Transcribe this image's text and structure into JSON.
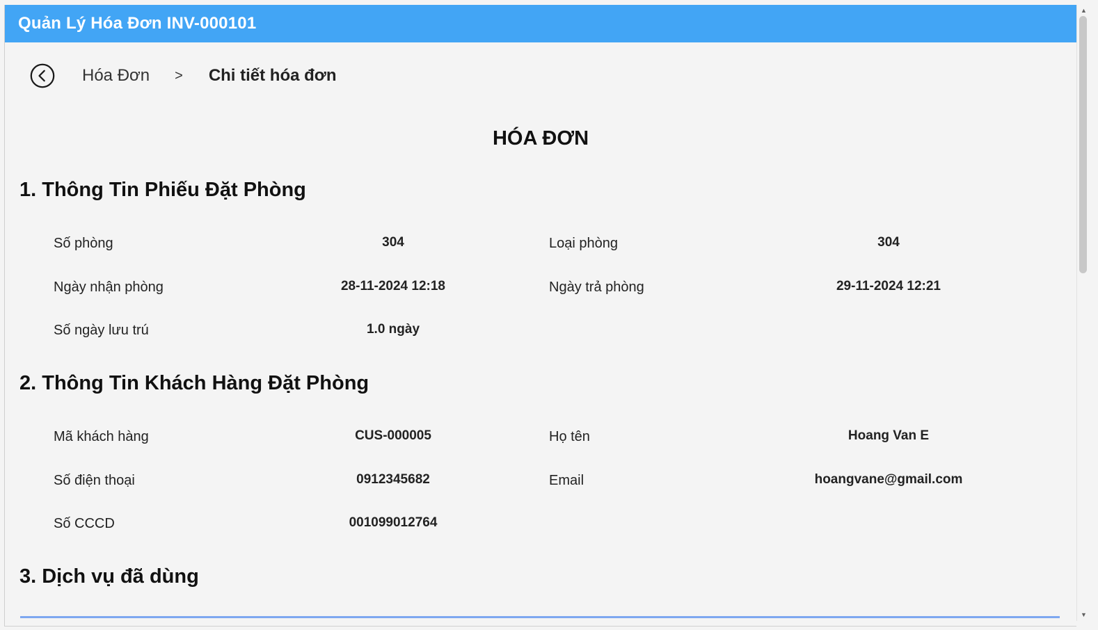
{
  "window": {
    "title": "Quản Lý Hóa Đơn INV-000101"
  },
  "breadcrumb": {
    "back_icon": "chevron-left-circle-icon",
    "parent": "Hóa Đơn",
    "separator": ">",
    "current": "Chi tiết hóa đơn"
  },
  "document": {
    "title": "HÓA ĐƠN"
  },
  "section1": {
    "title": "1. Thông Tin Phiếu Đặt Phòng",
    "fields": [
      {
        "label": "Số phòng",
        "value": "304"
      },
      {
        "label": "Loại phòng",
        "value": "304"
      },
      {
        "label": "Ngày nhận phòng",
        "value": "28-11-2024 12:18"
      },
      {
        "label": "Ngày trả phòng",
        "value": "29-11-2024 12:21"
      },
      {
        "label": "Số ngày lưu trú",
        "value": "1.0 ngày"
      }
    ]
  },
  "section2": {
    "title": "2. Thông Tin Khách Hàng Đặt Phòng",
    "fields": [
      {
        "label": "Mã khách hàng",
        "value": "CUS-000005"
      },
      {
        "label": "Họ tên",
        "value": "Hoang Van E"
      },
      {
        "label": "Số điện thoại",
        "value": "0912345682"
      },
      {
        "label": "Email",
        "value": "hoangvane@gmail.com"
      },
      {
        "label": "Số CCCD",
        "value": "001099012764"
      }
    ]
  },
  "section3": {
    "title": "3.  Dịch vụ đã dùng"
  },
  "colors": {
    "titlebar": "#42a5f5",
    "background": "#f4f4f4",
    "table_border": "#7da7f0"
  }
}
